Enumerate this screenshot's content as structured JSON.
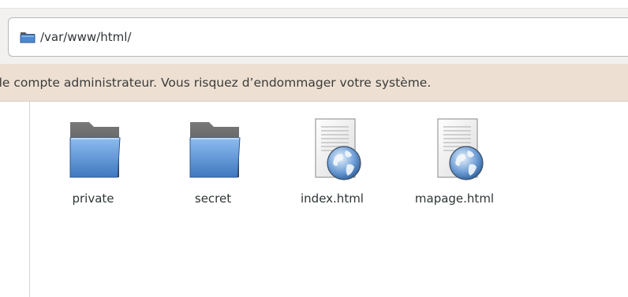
{
  "location": {
    "path": "/var/www/html/",
    "icon": "folder-icon"
  },
  "warning": {
    "text": "ez le compte administrateur. Vous risquez d’endommager votre système."
  },
  "files": [
    {
      "name": "private",
      "icon": "folder-icon"
    },
    {
      "name": "secret",
      "icon": "folder-icon"
    },
    {
      "name": "index.html",
      "icon": "html-document-icon"
    },
    {
      "name": "mapage.html",
      "icon": "html-document-icon"
    }
  ],
  "colors": {
    "warning_background": "#ede0d2",
    "folder_blue": "#4f88cc",
    "folder_back": "#5c5c5c"
  }
}
